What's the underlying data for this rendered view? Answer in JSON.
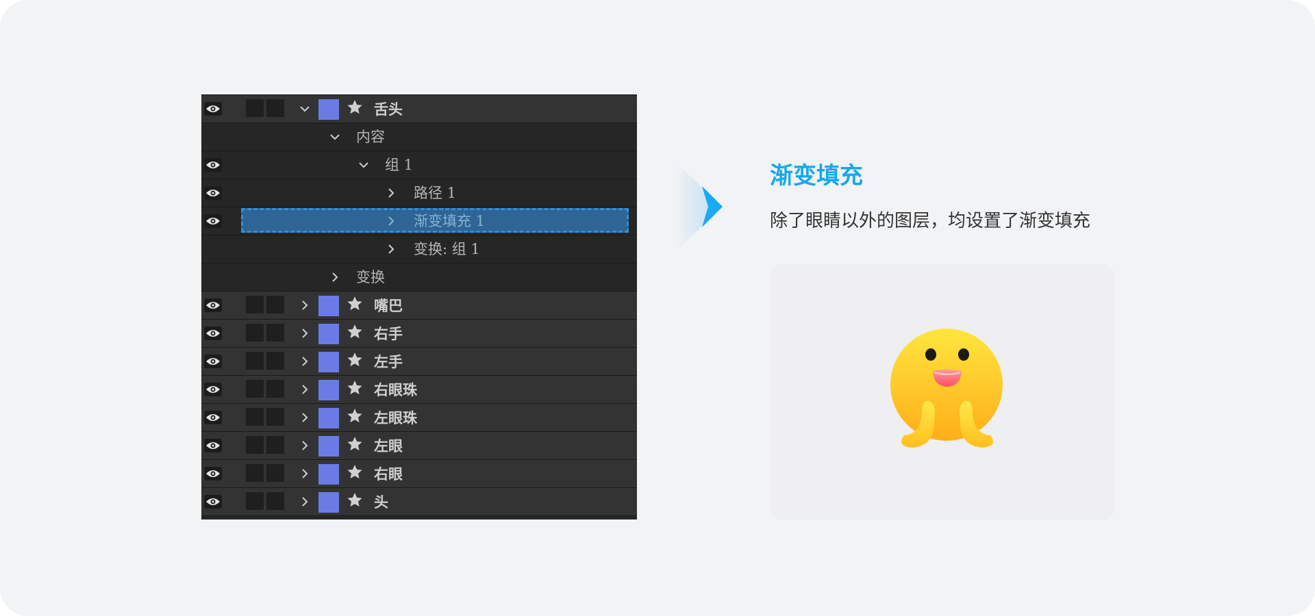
{
  "layers_panel": {
    "rows": [
      {
        "name": "舌头",
        "kind": "layer",
        "expanded": true
      },
      {
        "name": "内容",
        "kind": "group",
        "expanded": true,
        "depth": 1
      },
      {
        "name": "组 1",
        "kind": "group",
        "expanded": true,
        "depth": 2
      },
      {
        "name": "路径 1",
        "kind": "item",
        "expanded": false,
        "depth": 3
      },
      {
        "name": "渐变填充 1",
        "kind": "item",
        "expanded": false,
        "depth": 3,
        "selected": true
      },
      {
        "name": "变换: 组 1",
        "kind": "item",
        "expanded": false,
        "depth": 3
      },
      {
        "name": "变换",
        "kind": "item",
        "expanded": false,
        "depth": 1
      },
      {
        "name": "嘴巴",
        "kind": "layer",
        "expanded": false
      },
      {
        "name": "右手",
        "kind": "layer",
        "expanded": false
      },
      {
        "name": "左手",
        "kind": "layer",
        "expanded": false
      },
      {
        "name": "右眼珠",
        "kind": "layer",
        "expanded": false
      },
      {
        "name": "左眼珠",
        "kind": "layer",
        "expanded": false
      },
      {
        "name": "左眼",
        "kind": "layer",
        "expanded": false
      },
      {
        "name": "右眼",
        "kind": "layer",
        "expanded": false
      },
      {
        "name": "头",
        "kind": "layer",
        "expanded": false
      }
    ],
    "layer_color": "#6b7be6",
    "selection_color": "#2e6594"
  },
  "info": {
    "title": "渐变填充",
    "description": "除了眼睛以外的图层，均设置了渐变填充"
  },
  "colors": {
    "accent": "#15a8ee",
    "background": "#f2f3f5",
    "panel": "#262626",
    "mascot_top": "#ffe03a",
    "mascot_bottom": "#ffb31a",
    "tongue": "#ff5a6a"
  },
  "icons": {
    "visibility": "eye-icon",
    "expand": "chevron-down-icon",
    "collapse": "chevron-right-icon",
    "shape_layer": "star-icon",
    "next": "arrow-right-icon"
  }
}
